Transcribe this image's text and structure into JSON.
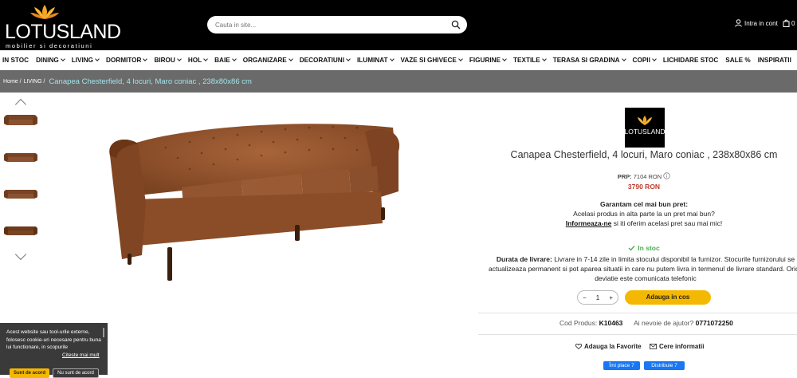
{
  "header": {
    "logo_text": "LOTUSLAND",
    "logo_sub": "mobilier si decoratiuni",
    "search_placeholder": "Cauta in site...",
    "account_label": "Intra in cont",
    "cart_count": "0"
  },
  "nav": {
    "items": [
      {
        "label": "IN STOC",
        "dropdown": false
      },
      {
        "label": "DINING",
        "dropdown": true
      },
      {
        "label": "LIVING",
        "dropdown": true
      },
      {
        "label": "DORMITOR",
        "dropdown": true
      },
      {
        "label": "BIROU",
        "dropdown": true
      },
      {
        "label": "HOL",
        "dropdown": true
      },
      {
        "label": "BAIE",
        "dropdown": true
      },
      {
        "label": "ORGANIZARE",
        "dropdown": true
      },
      {
        "label": "DECORATIUNI",
        "dropdown": true
      },
      {
        "label": "ILUMINAT",
        "dropdown": true
      },
      {
        "label": "VAZE SI GHIVECE",
        "dropdown": true
      },
      {
        "label": "FIGURINE",
        "dropdown": true
      },
      {
        "label": "TEXTILE",
        "dropdown": true
      },
      {
        "label": "TERASA SI GRADINA",
        "dropdown": true
      },
      {
        "label": "COPII",
        "dropdown": true
      },
      {
        "label": "LICHIDARE STOC",
        "dropdown": false
      },
      {
        "label": "SALE %",
        "dropdown": false
      },
      {
        "label": "INSPIRATII",
        "dropdown": false
      }
    ]
  },
  "breadcrumb": {
    "home": "Home /",
    "living": "LIVING /",
    "current": "Canapea Chesterfield, 4 locuri, Maro coniac , 238x80x86 cm"
  },
  "product": {
    "brand_logo_text": "LOTUSLAND",
    "title": "Canapea Chesterfield, 4 locuri, Maro coniac , 238x80x86 cm",
    "prp_label": "PRP:",
    "prp_value": "7104 RON",
    "price": "3790 RON",
    "guarantee_title": "Garantam cel mai bun pret:",
    "guarantee_line1": "Acelasi produs in alta parte la un pret mai bun?",
    "guarantee_link": "Informeaza-ne",
    "guarantee_line2_rest": " si iti oferim acelasi pret sau mai mic!",
    "stock": "In stoc",
    "delivery_label": "Durata de livrare:",
    "delivery_text": " Livrare in 7-14 zile in limita stocului disponibil la furnizor. Stocurile furnizorului se actualizeaza permanent si pot aparea situatii in care nu putem livra in termenul de livrare standard. Orice deviatie este comunicata telefonic",
    "qty_minus": "−",
    "qty_value": "1",
    "qty_plus": "+",
    "add_to_cart": "Adauga in cos",
    "code_label": "Cod Produs:",
    "code_value": "K10463",
    "help_label": "Ai nevoie de ajutor?",
    "help_phone": "0771072250",
    "favorite_label": "Adauga la Favorite",
    "request_label": "Cere informatii",
    "fb_like": "Îmi place 7",
    "fb_share": "Distribuie 7"
  },
  "cookie": {
    "text": "Acest website sau tool-urile externe, folosesc cookie-uri necesare pentru buna lui functionare, in scopurile",
    "more": "Citeste mai mult",
    "accept": "Sunt de acord",
    "deny": "Nu sunt de acord"
  },
  "colors": {
    "header_bg": "#000000",
    "breadcrumb_bg": "#6a6a6a",
    "price_red": "#c0392b",
    "stock_green": "#4caf50",
    "cart_button": "#f5b800",
    "facebook": "#1877f2"
  }
}
